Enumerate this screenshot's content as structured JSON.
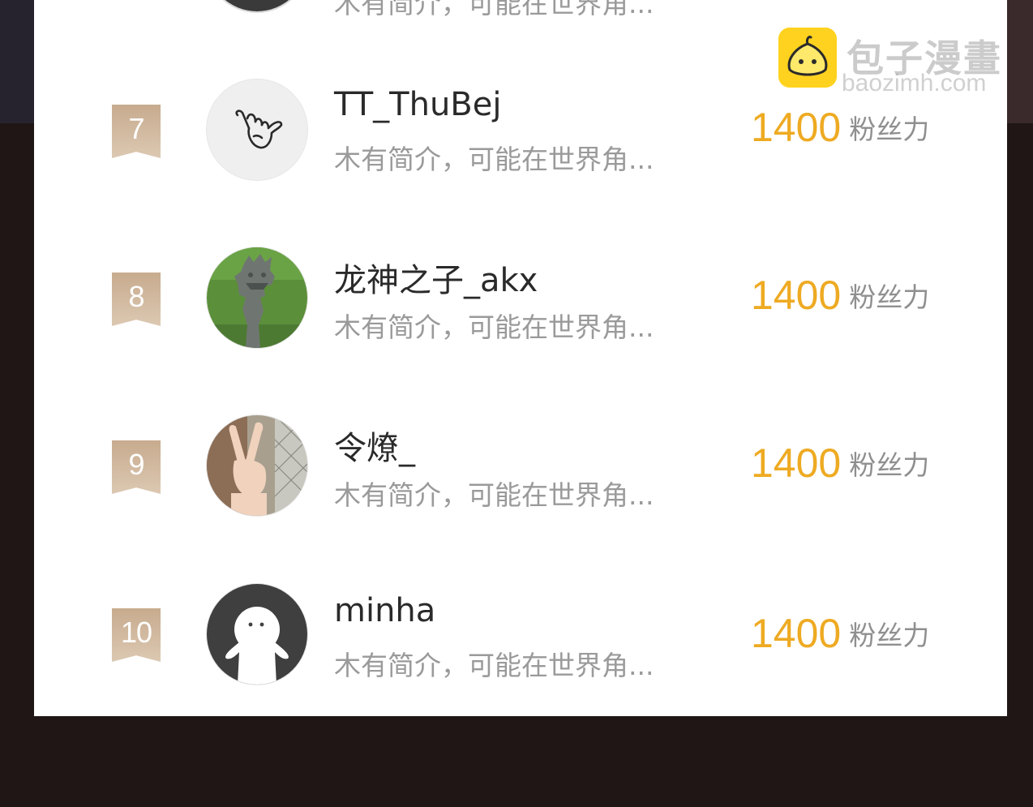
{
  "watermark": {
    "title": "包子漫畫",
    "url": "baozimh.com"
  },
  "previous_row": {
    "bio": "木有简介，可能在世界角..."
  },
  "ranking": [
    {
      "rank": "7",
      "name": "TT_ThuBej",
      "bio": "木有简介，可能在世界角...",
      "score": "1400",
      "score_label": "粉丝力",
      "avatar_icon": "shaka-hand-icon"
    },
    {
      "rank": "8",
      "name": "龙神之子_akx",
      "bio": "木有简介，可能在世界角...",
      "score": "1400",
      "score_label": "粉丝力",
      "avatar_icon": "dragon-statue-photo"
    },
    {
      "rank": "9",
      "name": "令燎_",
      "bio": "木有简介，可能在世界角...",
      "score": "1400",
      "score_label": "粉丝力",
      "avatar_icon": "peace-sign-hand-photo"
    },
    {
      "rank": "10",
      "name": "minha",
      "bio": "木有简介，可能在世界角...",
      "score": "1400",
      "score_label": "粉丝力",
      "avatar_icon": "ghost-figure-icon"
    }
  ],
  "colors": {
    "score": "#eeaa22",
    "rank_badge": "#c7ab8e",
    "background": "#1f1615"
  }
}
